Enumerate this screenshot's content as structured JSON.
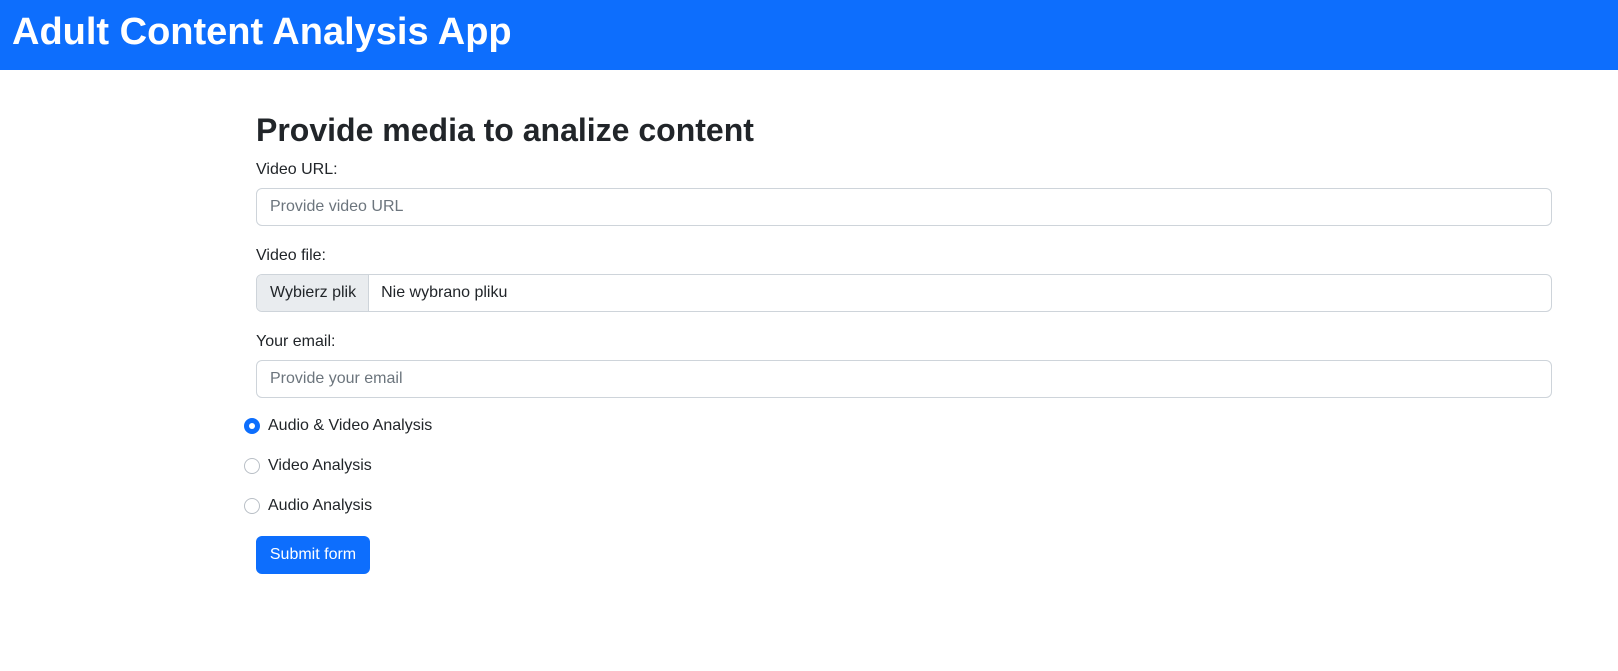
{
  "header": {
    "title": "Adult Content Analysis App",
    "background_color": "#0d6efd"
  },
  "form": {
    "title": "Provide media to analize content",
    "video_url": {
      "label": "Video URL:",
      "placeholder": "Provide video URL",
      "value": ""
    },
    "video_file": {
      "label": "Video file:",
      "button_label": "Wybierz plik",
      "status": "Nie wybrano pliku"
    },
    "email": {
      "label": "Your email:",
      "placeholder": "Provide your email",
      "value": ""
    },
    "analysis_options": [
      {
        "label": "Audio & Video Analysis",
        "checked": true
      },
      {
        "label": "Video Analysis",
        "checked": false
      },
      {
        "label": "Audio Analysis",
        "checked": false
      }
    ],
    "submit_label": "Submit form",
    "accent_color": "#0d6efd"
  }
}
